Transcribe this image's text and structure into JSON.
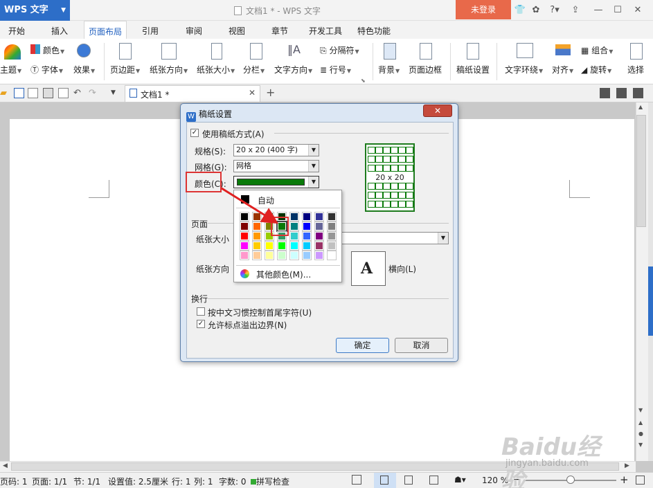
{
  "titlebar": {
    "app_name": "WPS 文字",
    "document_title": "文档1 * - WPS 文字",
    "login_label": "未登录",
    "help_label": "?"
  },
  "menu": {
    "tabs": [
      "开始",
      "插入",
      "页面布局",
      "引用",
      "审阅",
      "视图",
      "章节",
      "开发工具",
      "特色功能"
    ],
    "active": "页面布局"
  },
  "ribbon": {
    "theme": "主题",
    "color": "颜色",
    "font": "字体",
    "effects": "效果",
    "margins": "页边距",
    "orientation": "纸张方向",
    "size": "纸张大小",
    "columns": "分栏",
    "text_direction": "文字方向",
    "separator": "分隔符",
    "line_numbers": "行号",
    "background": "背景",
    "page_border": "页面边框",
    "manuscript_setup": "稿纸设置",
    "text_wrap": "文字环绕",
    "align": "对齐",
    "group": "组合",
    "rotate": "旋转",
    "select": "选择"
  },
  "doc_tab": {
    "label": "文档1 *"
  },
  "dialog": {
    "title": "稿纸设置",
    "use_manuscript_label": "使用稿纸方式(A)",
    "use_manuscript_checked": true,
    "spec_label": "规格(S):",
    "spec_value": "20 x 20 (400 字)",
    "grid_label": "网格(G):",
    "grid_value": "网格",
    "color_label": "颜色(C):",
    "color_value": "#0a7a0a",
    "preview_label": "20 x 20",
    "page_section": "页面",
    "paper_size_label": "纸张大小",
    "paper_orientation_label": "纸张方向",
    "landscape_label": "横向(L)",
    "line_break_section": "换行",
    "option_chinese_rules": "按中文习惯控制首尾字符(U)",
    "option_chinese_rules_checked": false,
    "option_punct_overflow": "允许标点溢出边界(N)",
    "option_punct_overflow_checked": true,
    "ok_label": "确定",
    "cancel_label": "取消"
  },
  "color_popup": {
    "auto_label": "自动",
    "more_colors_label": "其他颜色(M)...",
    "selected_color": "#0a7a0a",
    "rows": [
      [
        "#000000",
        "#993300",
        "#333300",
        "#003300",
        "#003366",
        "#000080",
        "#333399",
        "#333333"
      ],
      [
        "#800000",
        "#ff6600",
        "#808000",
        "#0a7a0a",
        "#008080",
        "#0000ff",
        "#666699",
        "#808080"
      ],
      [
        "#ff0000",
        "#ff9900",
        "#99cc00",
        "#339966",
        "#33cccc",
        "#3366ff",
        "#800080",
        "#969696"
      ],
      [
        "#ff00ff",
        "#ffcc00",
        "#ffff00",
        "#00ff00",
        "#00ffff",
        "#00ccff",
        "#993366",
        "#c0c0c0"
      ],
      [
        "#ff99cc",
        "#ffcc99",
        "#ffff99",
        "#ccffcc",
        "#ccffff",
        "#99ccff",
        "#cc99ff",
        "#ffffff"
      ]
    ]
  },
  "statusbar": {
    "page_code": "页码: 1",
    "pages": "页面: 1/1",
    "section": "节: 1/1",
    "setting": "设置值: 2.5厘米",
    "row": "行: 1",
    "col": "列: 1",
    "word_count": "字数: 0",
    "spell_check": "拼写检查",
    "zoom": "120 %"
  },
  "watermark": {
    "brand": "Baidu经验",
    "url": "jingyan.baidu.com"
  }
}
